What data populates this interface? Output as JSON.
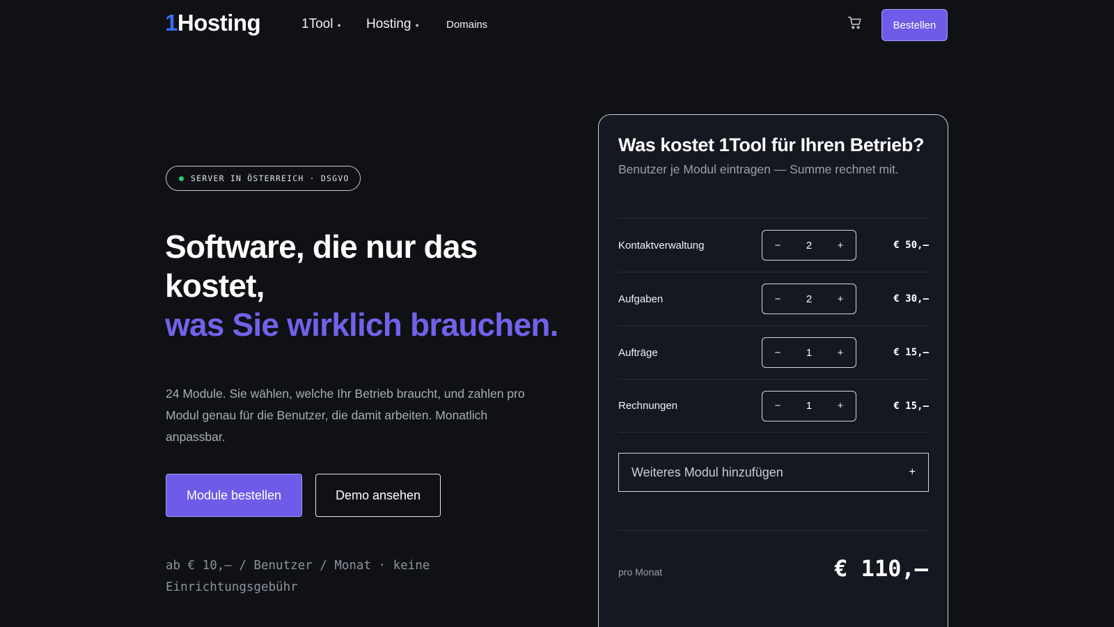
{
  "nav": {
    "logo_prefix": "1",
    "logo_rest": "Hosting",
    "items": [
      {
        "label": "1Tool",
        "has_dropdown": true
      },
      {
        "label": "Hosting",
        "has_dropdown": true
      },
      {
        "label": "Domains",
        "has_dropdown": false
      }
    ],
    "cart_icon": "cart-icon",
    "order_label": "Bestellen"
  },
  "hero": {
    "badge": "SERVER IN ÖSTERREICH · DSGVO",
    "headline_line1": "Software, die nur das kostet,",
    "headline_accent": "was Sie wirklich brauchen.",
    "lead": "24 Module. Sie wählen, welche Ihr Betrieb braucht, und zahlen pro Modul genau für die Benutzer, die damit arbeiten. Monatlich anpassbar.",
    "primary_button": "Module bestellen",
    "secondary_button": "Demo ansehen",
    "fine_print": "ab € 10,– / Benutzer / Monat · keine Einrichtungsgebühr"
  },
  "calculator": {
    "title": "Was kostet 1Tool für Ihren Betrieb?",
    "subtitle": "Benutzer je Modul eintragen — Summe rechnet mit.",
    "rows": [
      {
        "label": "Kontaktverwaltung",
        "users": "2",
        "price": "€ 50,–"
      },
      {
        "label": "Aufgaben",
        "users": "2",
        "price": "€ 30,–"
      },
      {
        "label": "Aufträge",
        "users": "1",
        "price": "€ 15,–"
      },
      {
        "label": "Rechnungen",
        "users": "1",
        "price": "€ 15,–"
      }
    ],
    "minus_symbol": "−",
    "plus_symbol": "+",
    "add_module": "Weiteres Modul hinzufügen",
    "add_module_plus": "+",
    "total_label": "pro Monat",
    "total_value": "€ 110,–"
  },
  "colors": {
    "background": "#0f1115",
    "accent": "#6c5ce7",
    "accent_text": "#7461ea",
    "logo_blue": "#3b6cf5",
    "status_green": "#2ecc71"
  }
}
